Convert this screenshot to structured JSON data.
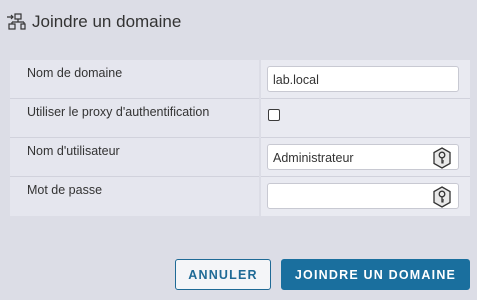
{
  "dialog": {
    "title": "Joindre un domaine",
    "title_icon": "join-domain-icon"
  },
  "form": {
    "domain": {
      "label": "Nom de domaine",
      "value": "lab.local"
    },
    "proxy": {
      "label": "Utiliser le proxy d'authentification",
      "checked": false
    },
    "username": {
      "label": "Nom d'utilisateur",
      "value": "Administrateur",
      "icon": "key-icon"
    },
    "password": {
      "label": "Mot de passe",
      "value": "",
      "icon": "key-icon"
    }
  },
  "buttons": {
    "cancel_label": "ANNULER",
    "join_label": "JOINDRE UN DOMAINE"
  },
  "colors": {
    "accent": "#1a6f9e",
    "background": "#dcdde6"
  }
}
